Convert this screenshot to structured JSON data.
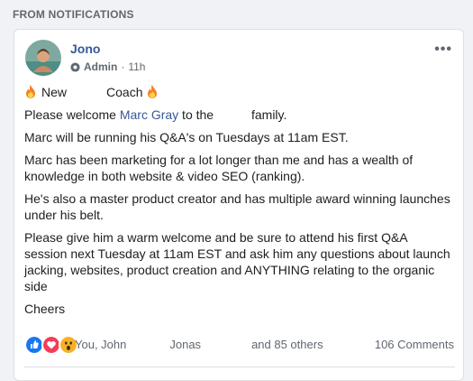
{
  "section": {
    "label": "FROM NOTIFICATIONS"
  },
  "post": {
    "author": "Jono",
    "role": "Admin",
    "separator": "·",
    "time": "11h",
    "more_label": "•••",
    "headline": {
      "pre": "New",
      "post": "Coach"
    },
    "welcome": {
      "pre": "Please welcome ",
      "name": "Marc Gray",
      "mid": " to the",
      "post": " family."
    },
    "paragraphs": [
      "Marc will be running his Q&A's on Tuesdays at 11am EST.",
      "Marc has been marketing for a lot longer than me and has a wealth of knowledge in both website & video SEO (ranking).",
      "He's also a master product creator and has multiple award winning launches under his belt.",
      "Please give him a warm welcome and be sure to attend his first Q&A session next Tuesday at 11am EST and ask him any questions about launch jacking, websites, product creation and ANYTHING relating to the organic side",
      "Cheers"
    ],
    "reactions": {
      "icons": [
        "like-icon",
        "love-icon",
        "wow-icon"
      ],
      "names": {
        "first": "You, John",
        "second": "Jonas",
        "third": "and 85 others"
      }
    },
    "comments_label": "106 Comments"
  },
  "colors": {
    "link": "#385898",
    "like": "#1877f2",
    "love": "#f33e58",
    "wow": "#f7b125",
    "fire": "#f5821f"
  }
}
